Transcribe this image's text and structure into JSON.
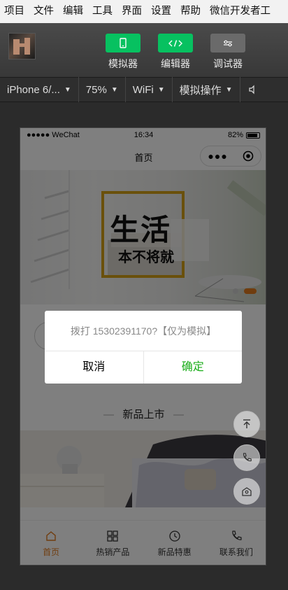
{
  "menubar": {
    "items": [
      "项目",
      "文件",
      "编辑",
      "工具",
      "界面",
      "设置",
      "帮助",
      "微信开发者工"
    ]
  },
  "toolbar": {
    "simulator": "模拟器",
    "editor": "编辑器",
    "debugger": "调试器",
    "simulator_color": "#07c160",
    "editor_color": "#07c160",
    "debugger_color": "#6a6a6a"
  },
  "device_bar": {
    "device": "iPhone 6/...",
    "zoom": "75%",
    "network": "WiFi",
    "operation": "模拟操作"
  },
  "phone": {
    "status": {
      "carrier": "●●●●● WeChat",
      "time": "16:34",
      "battery": "82%"
    },
    "nav_title": "首页",
    "banner": {
      "title_line1": "生活",
      "title_line2": "本不将就",
      "accent": "#d4a017"
    },
    "section_title": "新品上市",
    "tabs": [
      {
        "label": "首页",
        "icon": "home-icon",
        "active": true
      },
      {
        "label": "热销产品",
        "icon": "grid-icon",
        "active": false
      },
      {
        "label": "新品特惠",
        "icon": "clock-icon",
        "active": false
      },
      {
        "label": "联系我们",
        "icon": "phone-icon",
        "active": false
      }
    ],
    "active_color": "#e07a1f",
    "dialog": {
      "message": "拨打 15302391170?【仅为模拟】",
      "cancel": "取消",
      "confirm": "确定",
      "confirm_color": "#1aad19"
    }
  }
}
